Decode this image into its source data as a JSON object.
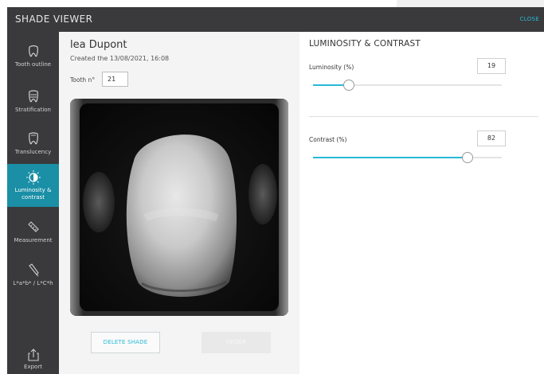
{
  "app": {
    "title": "SHADE VIEWER",
    "close_label": "CLOSE"
  },
  "sidebar": {
    "items": [
      {
        "label": "Tooth outline",
        "icon": "tooth-outline-icon",
        "active": false
      },
      {
        "label": "Stratification",
        "icon": "stratification-icon",
        "active": false
      },
      {
        "label": "Translucency",
        "icon": "translucency-icon",
        "active": false
      },
      {
        "label": "Luminosity & contrast",
        "icon": "contrast-icon",
        "active": true
      },
      {
        "label": "Measurement",
        "icon": "ruler-icon",
        "active": false
      },
      {
        "label": "L*a*b* / L*C*h",
        "icon": "pipette-icon",
        "active": false
      },
      {
        "label": "Export",
        "icon": "export-icon",
        "active": false
      }
    ]
  },
  "patient": {
    "name": "lea Dupont",
    "created": "Created the 13/08/2021, 16:08",
    "tooth_label": "Tooth n°",
    "tooth_number": "21"
  },
  "actions": {
    "delete_label": "DELETE SHADE",
    "order_label": "ORDER"
  },
  "panel": {
    "title": "LUMINOSITY & CONTRAST",
    "luminosity": {
      "label": "Luminosity (%)",
      "value": "19",
      "percent": 19
    },
    "contrast": {
      "label": "Contrast (%)",
      "value": "82",
      "percent": 82
    }
  },
  "colors": {
    "accent": "#27b9d6",
    "sidebar_bg": "#3a3a3c",
    "active_bg": "#1a8fa6"
  }
}
